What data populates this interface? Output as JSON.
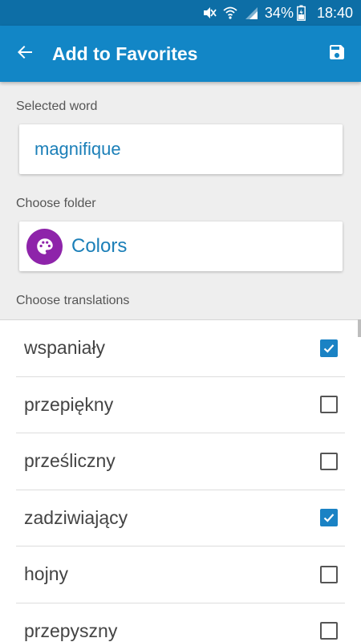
{
  "status_bar": {
    "icons": [
      "mute-icon",
      "wifi-icon",
      "signal-icon",
      "battery-icon"
    ],
    "battery": "34%",
    "time": "18:40"
  },
  "app_bar": {
    "title": "Add to Favorites",
    "back_icon": "arrow-back-icon",
    "save_icon": "save-icon",
    "color": "#1286c6"
  },
  "selected_word": {
    "label": "Selected word",
    "value": "magnifique"
  },
  "folder": {
    "label": "Choose folder",
    "name": "Colors",
    "icon": "palette-icon",
    "icon_color": "#8e24aa"
  },
  "translations": {
    "label": "Choose translations",
    "items": [
      {
        "text": "wspaniały",
        "checked": true
      },
      {
        "text": "przepiękny",
        "checked": false
      },
      {
        "text": "prześliczny",
        "checked": false
      },
      {
        "text": "zadziwiający",
        "checked": true
      },
      {
        "text": "hojny",
        "checked": false
      },
      {
        "text": "przepyszny",
        "checked": false
      }
    ]
  }
}
